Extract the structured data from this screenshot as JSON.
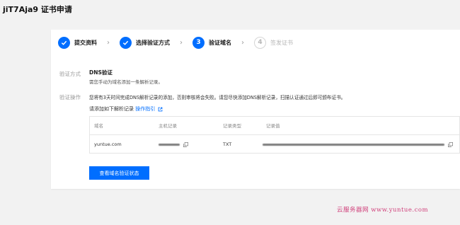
{
  "page": {
    "title": "jiT7Aja9 证书申请"
  },
  "steps": [
    {
      "label": "提交资料",
      "status": "done",
      "number": ""
    },
    {
      "label": "选择验证方式",
      "status": "done",
      "number": ""
    },
    {
      "label": "验证域名",
      "status": "active",
      "number": "3"
    },
    {
      "label": "签发证书",
      "status": "todo",
      "number": "4"
    }
  ],
  "verify_method": {
    "label": "验证方式",
    "title": "DNS验证",
    "desc": "需您手动为域名添加一条解析记录。"
  },
  "verify_steps": {
    "label": "验证操作",
    "notice": "您将有3天时间完成DNS解析记录的添加，否则审核将会失败。请您尽快添加DNS解析记录，扫描认证通过后即可颁布证书。",
    "instruction": "请添加如下解析记录",
    "guide_link": "操作指引"
  },
  "table": {
    "headers": [
      "域名",
      "主机记录",
      "记录类型",
      "记录值"
    ],
    "row": {
      "domain": "yuntue.com",
      "type": "TXT"
    }
  },
  "button": {
    "label": "查看域名验证状态"
  },
  "watermark": "云服务器网 www.yuntue.com",
  "colors": {
    "accent": "#006eff",
    "watermark": "#d0407b"
  }
}
